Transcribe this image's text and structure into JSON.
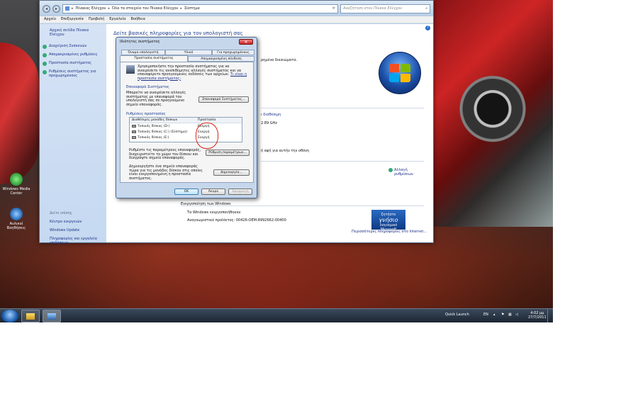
{
  "desktop": {
    "icons": [
      {
        "label": "Windows Media Center",
        "color": "#3aa840"
      },
      {
        "label": "Αυλικοί Βοηθήσεις",
        "color": "#2f74c0"
      }
    ]
  },
  "window": {
    "address": {
      "crumbs": [
        "Πίνακας Ελέγχου",
        "Όλα τα στοιχεία του Πίνακα Ελέγχου",
        "Σύστημα"
      ]
    },
    "search_placeholder": "Αναζήτηση στον Πίνακα Ελέγχου",
    "menu": [
      "Αρχείο",
      "Επεξεργασία",
      "Προβολή",
      "Εργαλεία",
      "Βοήθεια"
    ],
    "left_pane": {
      "home": "Αρχική σελίδα Πίνακα Ελέγχου",
      "links": [
        "Διαχείριση Συσκευών",
        "Απομακρυσμένες ρυθμίσεις",
        "Προστασία συστήματος",
        "Ρυθμίσεις συστήματος για προχωρημένους"
      ],
      "see_also": "Δείτε επίσης",
      "see_also_links": [
        "Κέντρο ενεργειών",
        "Windows Update",
        "Πληροφορίες και εργαλεία επιδόσεων"
      ]
    },
    "main": {
      "title": "Δείτε βασικές πληροφορίες για τον υπολογιστή σας",
      "fragments": {
        "rights": "ρημένα δικαιώματα.",
        "available": "ι διαθέσιμη",
        "speed": "2.89 GHz",
        "touch": "ή αφή για αυτήν την οθόνη",
        "change": "Αλλαγή ρυθμίσεων"
      },
      "activation_header": "Ενεργοποίηση των Windows",
      "activation_status": "Τα Windows ενεργοποιήθηκαν",
      "product_id": "Αναγνωριστικό προϊόντος: 00426-OEM-8992662-00400",
      "genuine_badge": {
        "top": "ζητήστε",
        "big": "γνήσιο",
        "brand": "λογισμικό Microsoft"
      },
      "more_info": "Περισσότερες πληροφορίες στο Internet..."
    }
  },
  "dialog": {
    "title": "Ιδιότητες συστήματος",
    "tabs_top": [
      "Όνομα υπολογιστή",
      "Υλικό",
      "Για προχωρημένους"
    ],
    "tabs_bottom": [
      "Προστασία συστήματος",
      "Απομακρυσμένη σύνδεση"
    ],
    "intro": "Χρησιμοποιήστε την προστασία συστήματος για να αναιρέσετε τις ανεπιθύμητες αλλαγές συστήματος και να επαναφέρετε προηγούμενες εκδόσεις των αρχείων.",
    "intro_link": "Τι είναι η προστασία συστήματος;",
    "restore_section": "Επαναφορά Συστήματος",
    "restore_text": "Μπορείτε να αναιρέσετε αλλαγές συστήματος με επαναφορά του υπολογιστή σας σε προηγούμενο σημείο επαναφοράς.",
    "restore_button": "Επαναφορά Συστήματος...",
    "protection_section": "Ρυθμίσεις προστασίας",
    "table": {
      "headers": [
        "Διαθέσιμες μονάδες δίσκων",
        "Προστασία"
      ],
      "rows": [
        {
          "drive": "Τοπικός δίσκος (D:)",
          "status": "Ενεργή"
        },
        {
          "drive": "Τοπικός δίσκος (C:) (Σύστημα)",
          "status": "Ενεργή"
        },
        {
          "drive": "Τοπικός δίσκος (E:)",
          "status": "Ενεργή"
        }
      ]
    },
    "configure_text": "Ρυθμίστε τις παραμέτρους επαναφοράς, διαχειριστείτε το χώρο του δίσκου και διαγράψτε σημεία επαναφοράς.",
    "configure_button": "Ρύθμιση παραμέτρων...",
    "create_text": "Δημιουργήστε ένα σημείο επαναφοράς τώρα για τις μονάδες δίσκου στις οποίες είναι ενεργοποιημένη η προστασία συστήματος.",
    "create_button": "Δημιουργία...",
    "ok": "OK",
    "cancel": "Άκυρο",
    "apply": "Εφαρμογή"
  },
  "taskbar": {
    "quick_launch": "Quick Launch",
    "lang": "EN",
    "time": "4:02 μμ",
    "date": "27/7/2011"
  }
}
